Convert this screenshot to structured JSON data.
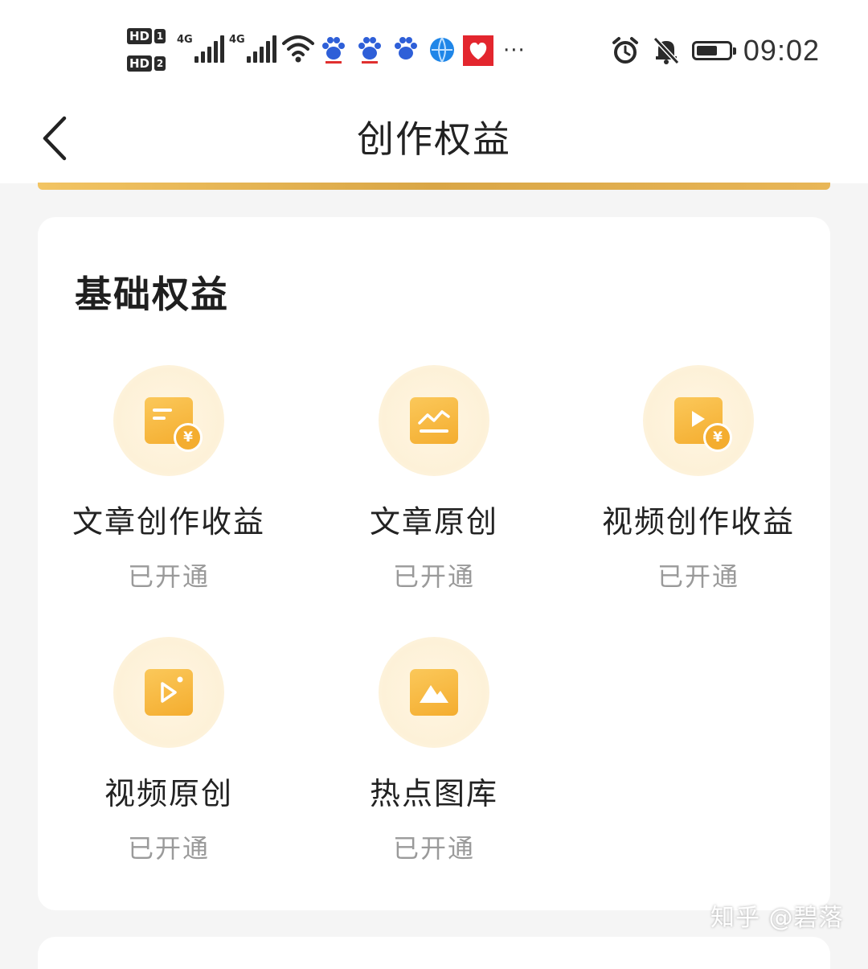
{
  "status_bar": {
    "sim1_label": "HD",
    "sim1_index": "1",
    "sim2_label": "HD",
    "sim2_index": "2",
    "network1": "4G",
    "network2": "4G",
    "more_indicator": "···",
    "time": "09:02",
    "icons": [
      "wifi-icon",
      "baidu-paw-icon",
      "baidu-paw-icon",
      "baidu-paw-icon",
      "browser-globe-icon",
      "red-app-icon",
      "alarm-icon",
      "bell-muted-icon",
      "battery-icon"
    ]
  },
  "nav": {
    "title": "创作权益",
    "back_icon": "chevron-left-icon"
  },
  "basic_benefits": {
    "title": "基础权益",
    "items": [
      {
        "name": "文章创作收益",
        "status": "已开通",
        "icon": "article-income-icon"
      },
      {
        "name": "文章原创",
        "status": "已开通",
        "icon": "article-original-icon"
      },
      {
        "name": "视频创作收益",
        "status": "已开通",
        "icon": "video-income-icon"
      },
      {
        "name": "视频原创",
        "status": "已开通",
        "icon": "video-original-icon"
      },
      {
        "name": "热点图库",
        "status": "已开通",
        "icon": "hot-gallery-icon"
      }
    ]
  },
  "watermark": "知乎 @碧落",
  "colors": {
    "accent_gold": "#f4ad2f",
    "halo": "#fdf1d8",
    "status_text": "#9a9a9a"
  }
}
